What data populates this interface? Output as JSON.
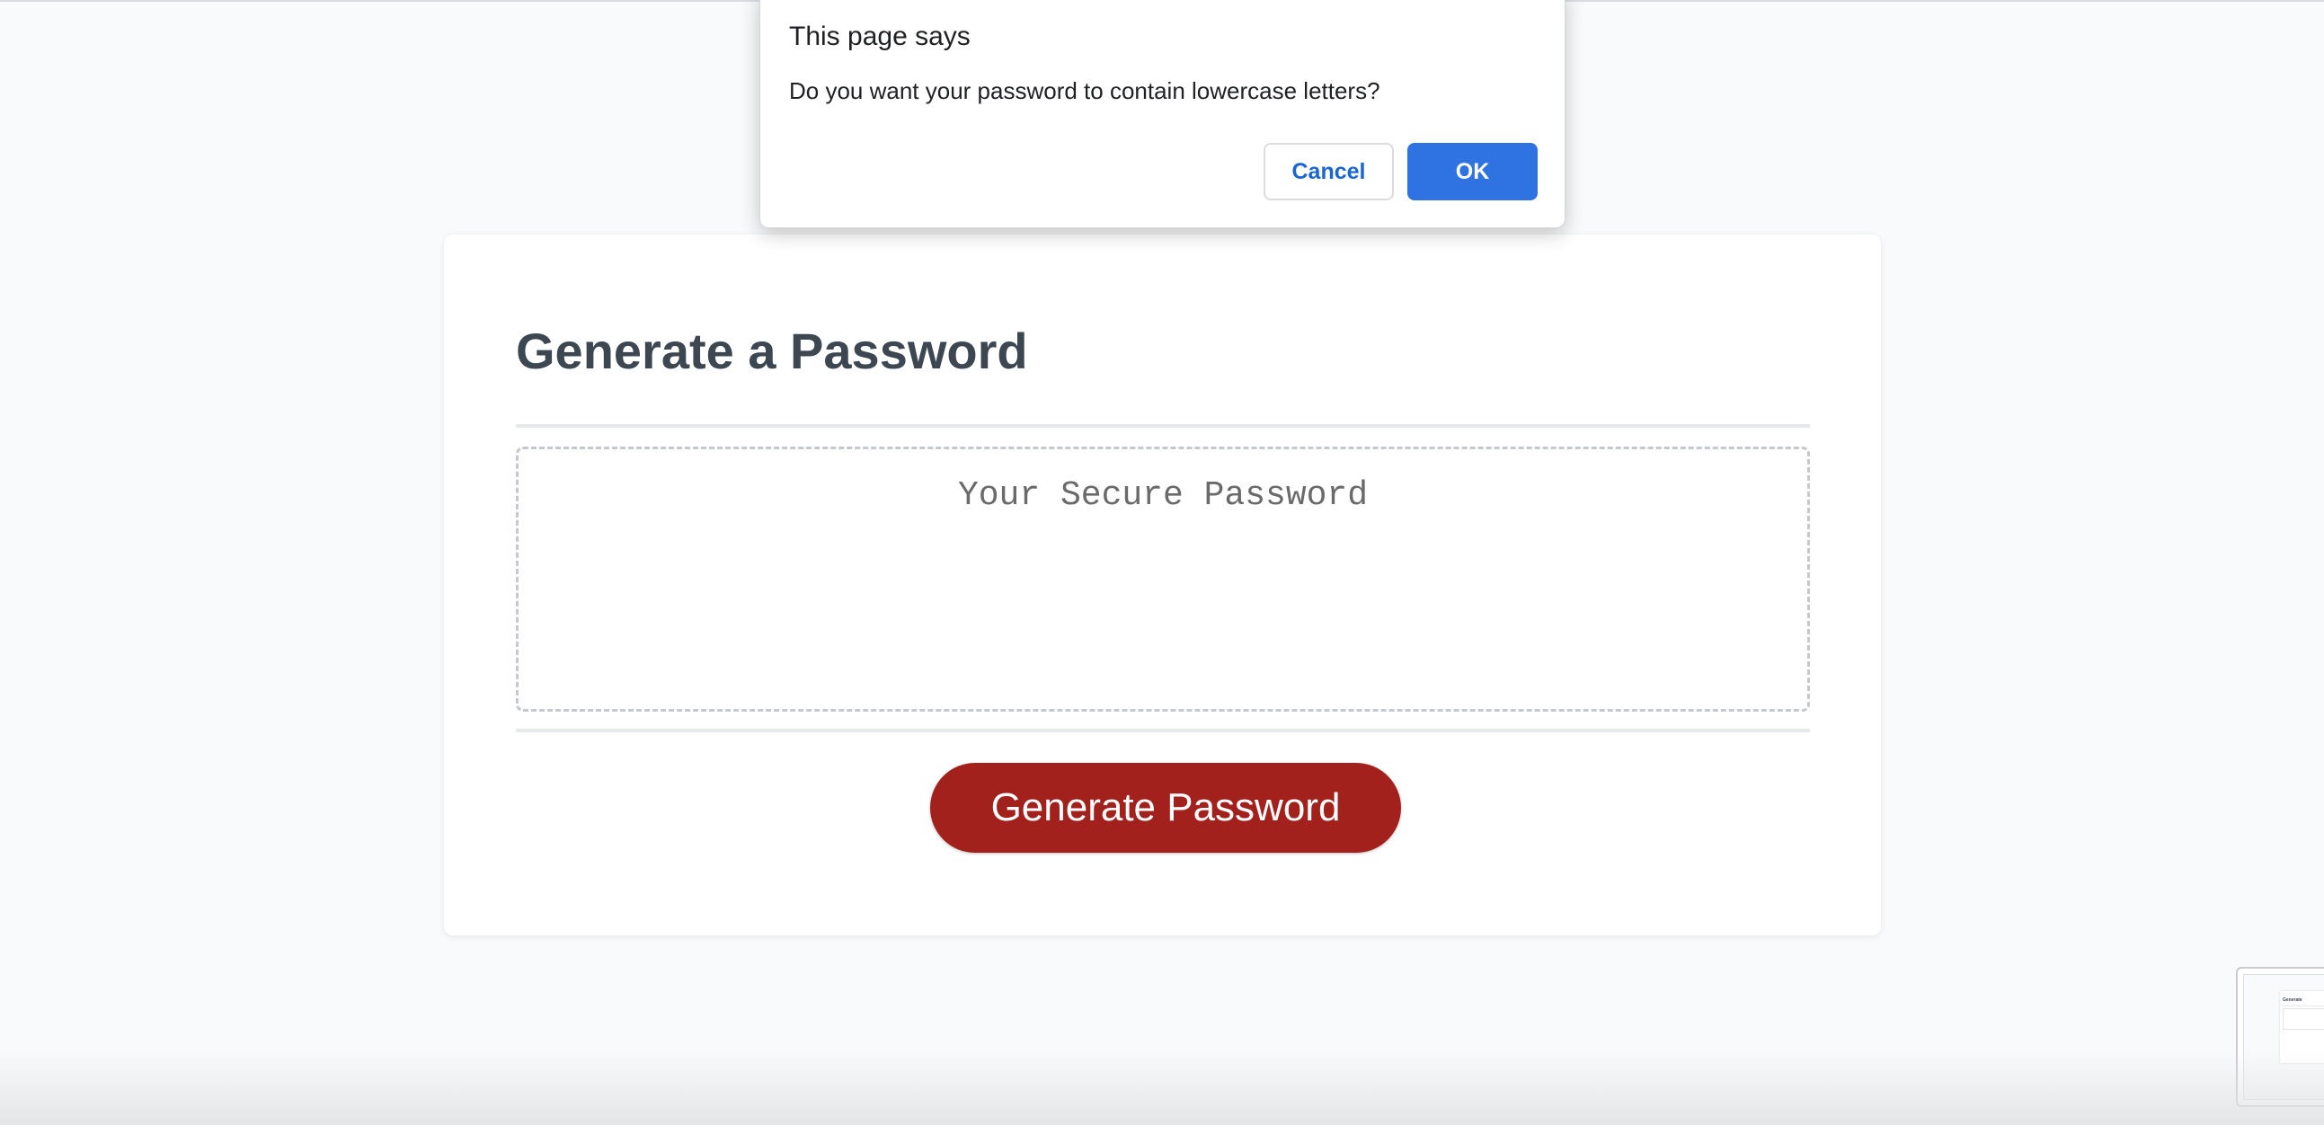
{
  "page": {
    "background_color": "#f9fafb"
  },
  "card": {
    "title": "Generate a Password",
    "password_placeholder": "Your Secure Password",
    "password_value": "",
    "generate_button_label": "Generate Password",
    "generate_button_color": "#a3211d",
    "title_color": "#3c4752"
  },
  "dialog": {
    "title": "This page says",
    "message": "Do you want your password to contain lowercase letters?",
    "cancel_label": "Cancel",
    "ok_label": "OK",
    "ok_color": "#2f72e1",
    "cancel_text_color": "#1a66d2"
  },
  "thumbnail": {
    "title": "Generate"
  }
}
